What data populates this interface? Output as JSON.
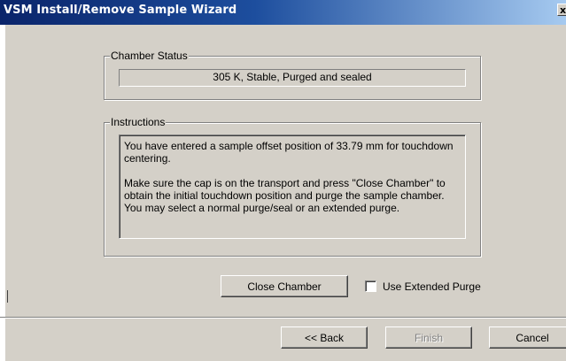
{
  "window": {
    "title": "VSM Install/Remove Sample Wizard",
    "close_glyph": "x"
  },
  "chamber_status": {
    "legend": "Chamber Status",
    "value": "305 K, Stable, Purged and sealed"
  },
  "instructions": {
    "legend": "Instructions",
    "paragraph1": "You have entered a sample offset position of 33.79 mm for touchdown centering.",
    "paragraph2": "Make sure the cap is on the transport and press \"Close Chamber\" to obtain the initial touchdown position and purge the sample chamber. You may select a normal purge/seal or an extended purge."
  },
  "actions": {
    "close_chamber_label": "Close Chamber",
    "extended_purge_label": "Use Extended Purge",
    "extended_purge_checked": false
  },
  "footer": {
    "back_label": "<< Back",
    "finish_label": "Finish",
    "finish_enabled": false,
    "cancel_label": "Cancel"
  },
  "colors": {
    "dialog_face": "#d4d0c8",
    "title_bar_start": "#0a246a",
    "title_bar_end": "#a6caf0",
    "disabled_text": "#808080"
  }
}
